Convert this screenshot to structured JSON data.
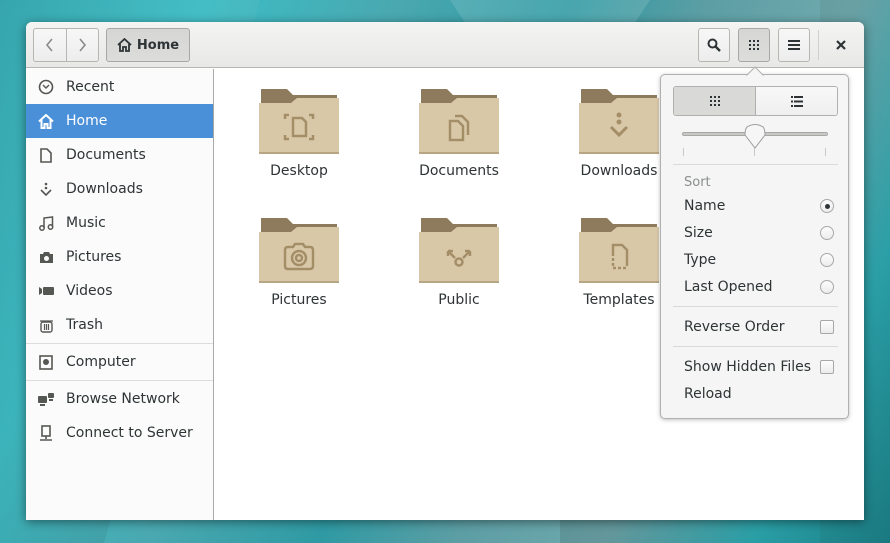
{
  "headerbar": {
    "back_icon": "chevron-left-icon",
    "forward_icon": "chevron-right-icon",
    "location_label": "Home",
    "location_icon": "home-icon",
    "search_icon": "search-icon",
    "view_icon": "grid-icon",
    "menu_icon": "hamburger-icon",
    "close_icon": "close-icon"
  },
  "sidebar": {
    "items": [
      {
        "label": "Recent",
        "icon": "clock-icon"
      },
      {
        "label": "Home",
        "icon": "home-icon",
        "selected": true
      },
      {
        "label": "Documents",
        "icon": "document-icon"
      },
      {
        "label": "Downloads",
        "icon": "download-icon"
      },
      {
        "label": "Music",
        "icon": "music-icon"
      },
      {
        "label": "Pictures",
        "icon": "camera-icon"
      },
      {
        "label": "Videos",
        "icon": "video-icon"
      },
      {
        "label": "Trash",
        "icon": "trash-icon"
      },
      {
        "label": "Computer",
        "icon": "computer-icon"
      },
      {
        "label": "Browse Network",
        "icon": "network-icon"
      },
      {
        "label": "Connect to Server",
        "icon": "server-icon"
      }
    ]
  },
  "folders": [
    {
      "label": "Desktop",
      "emblem": "desktop-emblem-icon"
    },
    {
      "label": "Documents",
      "emblem": "documents-emblem-icon"
    },
    {
      "label": "Downloads",
      "emblem": "download-emblem-icon"
    },
    {
      "label": "Pictures",
      "emblem": "camera-emblem-icon"
    },
    {
      "label": "Public",
      "emblem": "share-emblem-icon"
    },
    {
      "label": "Templates",
      "emblem": "template-emblem-icon"
    }
  ],
  "view_popover": {
    "view_modes": [
      {
        "name": "grid",
        "icon": "grid-icon",
        "active": true
      },
      {
        "name": "list",
        "icon": "list-icon",
        "active": false
      }
    ],
    "zoom_level_fraction": 0.5,
    "sort_header": "Sort",
    "sort_options": [
      {
        "label": "Name",
        "selected": true
      },
      {
        "label": "Size",
        "selected": false
      },
      {
        "label": "Type",
        "selected": false
      },
      {
        "label": "Last Opened",
        "selected": false
      }
    ],
    "reverse_order": {
      "label": "Reverse Order",
      "checked": false
    },
    "show_hidden": {
      "label": "Show Hidden Files",
      "checked": false
    },
    "reload_label": "Reload"
  },
  "colors": {
    "accent": "#4a90d9",
    "folder_body": "#d9c8a8",
    "folder_tab": "#8e7a5c",
    "desktop_bg": "#2fb0b8"
  }
}
